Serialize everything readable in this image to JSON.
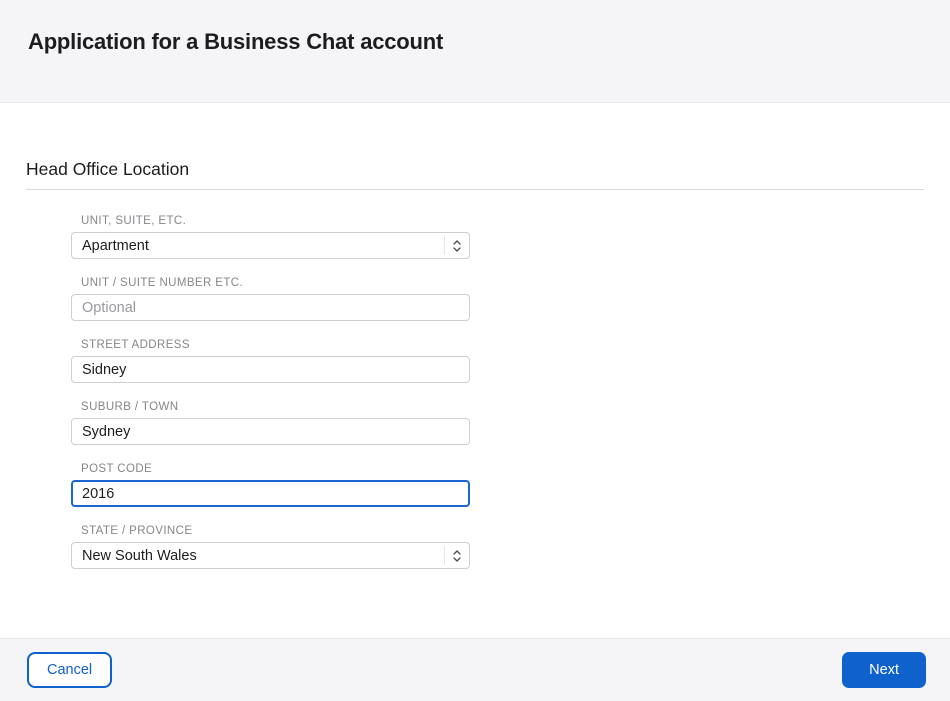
{
  "header": {
    "title": "Application for a Business Chat account"
  },
  "section": {
    "title": "Head Office Location"
  },
  "form": {
    "fields": [
      {
        "label": "UNIT, SUITE, ETC.",
        "type": "select",
        "value": "Apartment"
      },
      {
        "label": "UNIT / SUITE NUMBER ETC.",
        "type": "text",
        "value": "",
        "placeholder": "Optional"
      },
      {
        "label": "STREET ADDRESS",
        "type": "text",
        "value": "Sidney"
      },
      {
        "label": "SUBURB / TOWN",
        "type": "text",
        "value": "Sydney"
      },
      {
        "label": "POST CODE",
        "type": "text",
        "value": "2016",
        "focused": true
      },
      {
        "label": "STATE / PROVINCE",
        "type": "select",
        "value": "New South Wales"
      }
    ]
  },
  "footer": {
    "cancel_label": "Cancel",
    "next_label": "Next"
  },
  "icons": {
    "select_stepper": "up-down-chevrons"
  },
  "colors": {
    "accent": "#0f62cc",
    "focus_border": "#1a66d2",
    "header_bg": "#f5f5f7",
    "label_gray": "#86868b"
  }
}
